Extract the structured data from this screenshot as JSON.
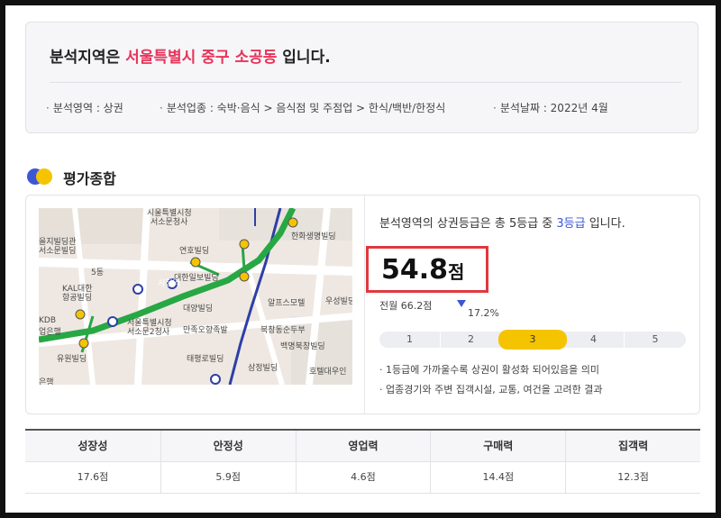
{
  "summary": {
    "title_prefix": "분석지역은 ",
    "region": "서울특별시 중구 소공동",
    "title_suffix": " 입니다.",
    "meta": [
      {
        "label": "분석영역",
        "value": "상권"
      },
      {
        "label": "분석업종",
        "value": "숙박·음식 > 음식점 및 주점업 > 한식/백반/한정식"
      },
      {
        "label": "분석날짜",
        "value": "2022년 4월"
      }
    ],
    "meta_separator": " : "
  },
  "section": {
    "title": "평가종합"
  },
  "colors": {
    "region": "#e8335a",
    "accent": "#3b57d6",
    "grade_active": "#f5c400",
    "highlight_box": "#e0383f"
  },
  "map": {
    "labels": [
      "서소문청사",
      "시울특별시청",
      "을지빌딩관",
      "서소문빌딩",
      "연호빌딩",
      "5동",
      "대한일보빌딩",
      "한화생명빌딩",
      "KAL대한",
      "항공빌딩",
      "대양빌딩",
      "시청역",
      "알프스모텔",
      "우성빌딩",
      "KDB",
      "업은행",
      "서울특별시청",
      "서소문2청사",
      "만족오향족발",
      "북창동순두부",
      "백명북창빌딩",
      "유원빌딩",
      "태평로빌딩",
      "삼정빌딩",
      "호텔대우인",
      "은행"
    ]
  },
  "grade": {
    "sentence_prefix": "분석영역의 상권등급은 총 5등급 중 ",
    "grade_text": "3등급",
    "sentence_suffix": " 입니다.",
    "score": "54.8",
    "score_unit": "점",
    "prev_label": "전월 66.2점",
    "change_pct": "17.2%",
    "change_direction": "down",
    "levels": [
      "1",
      "2",
      "3",
      "4",
      "5"
    ],
    "active_level": 3,
    "notes": [
      "· 1등급에 가까울수록 상권이 활성화 되어있음을 의미",
      "· 업종경기와 주변 집객시설, 교통, 여건을 고려한 결과"
    ]
  },
  "sub_scores": [
    {
      "label": "성장성",
      "value": "17.6점"
    },
    {
      "label": "안정성",
      "value": "5.9점"
    },
    {
      "label": "영업력",
      "value": "4.6점"
    },
    {
      "label": "구매력",
      "value": "14.4점"
    },
    {
      "label": "집객력",
      "value": "12.3점"
    }
  ]
}
